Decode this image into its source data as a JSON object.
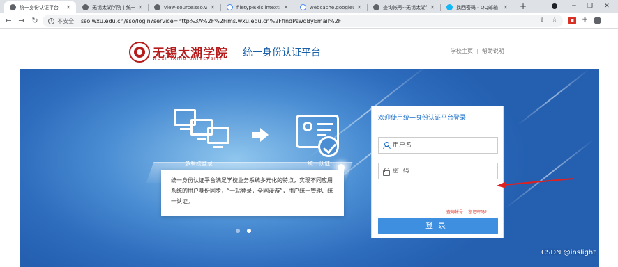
{
  "browser": {
    "tabs": [
      {
        "title": "统一身份认证平台",
        "favicon": "globe-icon",
        "active": true
      },
      {
        "title": "无锡太湖学院 | 统一身",
        "favicon": "globe-icon",
        "active": false
      },
      {
        "title": "view-source:sso.wxu",
        "favicon": "globe-icon",
        "active": false
      },
      {
        "title": "filetype:xls intext:\"无",
        "favicon": "google-icon",
        "active": false
      },
      {
        "title": "webcache.googleuser",
        "favicon": "google-icon",
        "active": false
      },
      {
        "title": "查询帐号--无锡太湖学院",
        "favicon": "globe-icon",
        "active": false
      },
      {
        "title": "找回密码 - QQ邮箱",
        "favicon": "qq-mail-icon",
        "active": false
      }
    ],
    "new_tab": "+",
    "security_label": "不安全",
    "url": "sso.wxu.edu.cn/sso/login?service=http%3A%2F%2Fims.wxu.edu.cn%2FfindPswdByEmail%2F"
  },
  "header": {
    "school_name_cn": "无锡太湖学院",
    "school_name_en": "WUXI TAIHU UNIVERSITY",
    "platform_title": "统一身份认证平台",
    "links": [
      "学校主页",
      "帮助说明"
    ]
  },
  "banner": {
    "label_multi": "多系统登录",
    "label_unified": "统一认证",
    "description": "统一身份认证平台满足学校业务系统多元化的特点，实现不同应用系统的用户身份同步，“一站登录，全网漫游”，用户统一管理、统一认证。",
    "slides": [
      false,
      true
    ]
  },
  "login": {
    "title": "欢迎使用统一身份认证平台登录",
    "username_placeholder": "用户名",
    "password_placeholder": "密  码",
    "query_account": "查询帐号",
    "forgot_password": "忘记密码?",
    "submit": "登录"
  },
  "watermark": "CSDN @inslight",
  "colors": {
    "brand_red": "#b71c1c",
    "brand_blue": "#1a6fc9",
    "button_blue": "#3f8fe0",
    "annotation_red": "#e02020"
  }
}
